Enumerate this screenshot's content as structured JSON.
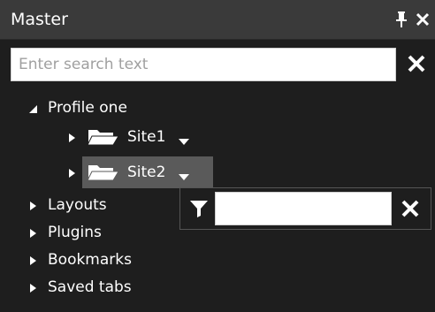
{
  "panel": {
    "title": "Master",
    "pin_icon": "pin-icon",
    "close_icon": "close-icon"
  },
  "search": {
    "placeholder": "Enter search text",
    "value": "",
    "clear_icon": "close-icon"
  },
  "tree": {
    "profile": {
      "label": "Profile one",
      "expanded": true
    },
    "sites": [
      {
        "label": "Site1",
        "icon": "folder-icon"
      },
      {
        "label": "Site2",
        "icon": "folder-icon",
        "selected": true
      }
    ],
    "groups": [
      {
        "label": "Layouts"
      },
      {
        "label": "Plugins"
      },
      {
        "label": "Bookmarks"
      },
      {
        "label": "Saved tabs"
      }
    ]
  },
  "filter_popup": {
    "value": "",
    "filter_icon": "filter-icon",
    "clear_icon": "close-icon"
  },
  "colors": {
    "background": "#1e1e1e",
    "titlebar": "#3a3a3a",
    "selection": "#5a5a5a",
    "text": "#ffffff"
  }
}
